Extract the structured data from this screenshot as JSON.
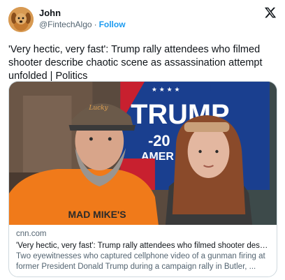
{
  "author": {
    "display_name": "John",
    "handle": "@FintechAlgo",
    "separator": "·",
    "follow_label": "Follow",
    "avatar_icon": "dog-avatar"
  },
  "header": {
    "platform_icon": "x-logo-icon"
  },
  "tweet": {
    "text": "'Very hectic, very fast': Trump rally attendees who filmed shooter describe chaotic scene as assassination attempt unfolded | Politics"
  },
  "link_card": {
    "domain": "cnn.com",
    "title": "'Very hectic, very fast': Trump rally attendees who filmed shooter describ...",
    "description": "Two eyewitnesses who captured cellphone video of a gunman firing at former President Donald Trump during a campaign rally in Butler, ...",
    "image": {
      "banner_text": "TRUMP",
      "banner_subtext": "-20",
      "banner_subtext2": "AMER",
      "shirt_text": "MAD MIKE'S",
      "cap_text": "Lucky"
    }
  },
  "colors": {
    "link_blue": "#1d9bf0",
    "secondary_text": "#536471",
    "border": "#cfd9de",
    "banner_blue": "#1a3f8f",
    "banner_red": "#c8202f",
    "shirt_orange": "#f07a1a"
  }
}
